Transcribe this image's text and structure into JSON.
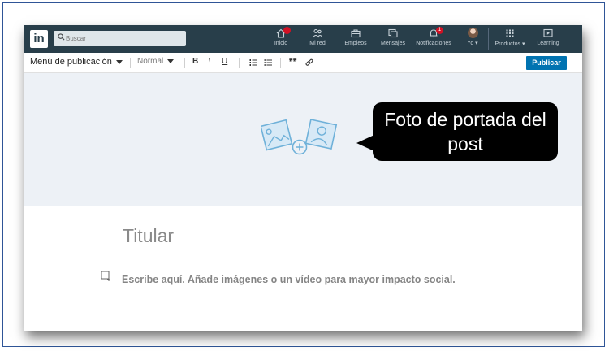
{
  "nav": {
    "logo": "in",
    "search_placeholder": "Buscar",
    "items": [
      {
        "label": "Inicio",
        "icon": "home-icon"
      },
      {
        "label": "Mi red",
        "icon": "network-icon"
      },
      {
        "label": "Empleos",
        "icon": "briefcase-icon"
      },
      {
        "label": "Mensajes",
        "icon": "messages-icon"
      },
      {
        "label": "Notificaciones",
        "icon": "bell-icon",
        "badge": "1"
      },
      {
        "label": "Yo",
        "icon": "avatar"
      },
      {
        "label": "Productos",
        "icon": "grid-icon"
      },
      {
        "label": "Learning",
        "icon": "play-icon"
      }
    ],
    "colors": {
      "bar": "#283e4a",
      "badge": "#d11124"
    }
  },
  "toolbar": {
    "menu_label": "Menú de publicación",
    "style_label": "Normal",
    "bold": "B",
    "italic": "I",
    "underline": "U",
    "quote": "❞❞",
    "publish_label": "Publicar",
    "publish_color": "#0073b1"
  },
  "cover": {
    "callout_text": "Foto de portada del post",
    "background": "#edf1f6"
  },
  "editor": {
    "headline_placeholder": "Titular",
    "body_placeholder": "Escribe aquí. Añade imágenes o un vídeo para mayor impacto social."
  }
}
